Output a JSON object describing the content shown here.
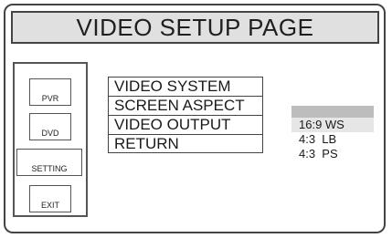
{
  "page": {
    "title": "VIDEO SETUP PAGE"
  },
  "side_buttons": [
    {
      "label": "PVR"
    },
    {
      "label": "DVD"
    },
    {
      "label": "SETTING"
    },
    {
      "label": "EXIT"
    }
  ],
  "menu": {
    "items": [
      {
        "label": "VIDEO SYSTEM"
      },
      {
        "label": "SCREEN ASPECT"
      },
      {
        "label": "VIDEO OUTPUT"
      },
      {
        "label": "RETURN"
      }
    ]
  },
  "aspect_options": {
    "selected": "16:9 WS",
    "items": [
      {
        "label": "16:9 WS"
      },
      {
        "label": "4:3  LB"
      },
      {
        "label": "4:3  PS"
      }
    ]
  },
  "colors": {
    "title_bar": "#e0e0e0",
    "option_header": "#bdbdbd",
    "selected_option": "#e6e6e6",
    "border": "#444444"
  }
}
